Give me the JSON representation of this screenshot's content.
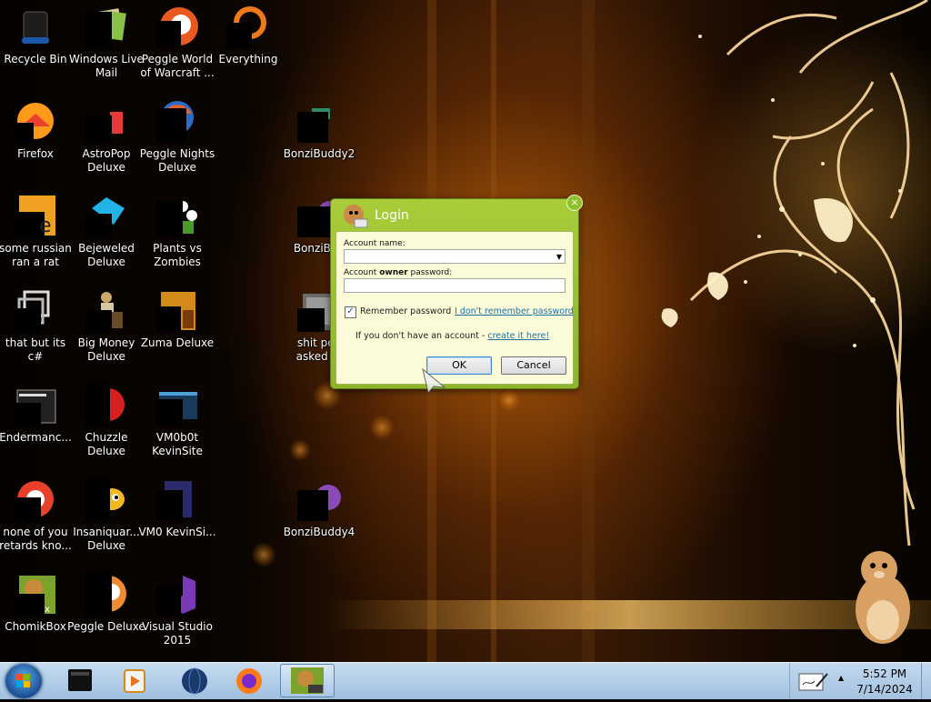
{
  "desktop_icons": [
    {
      "label": "Recycle Bin"
    },
    {
      "label": "Windows Live Mail"
    },
    {
      "label": "Peggle World of Warcraft ..."
    },
    {
      "label": "Everything"
    },
    {
      "label": "Firefox"
    },
    {
      "label": "AstroPop Deluxe"
    },
    {
      "label": "Peggle Nights Deluxe"
    },
    {
      "label": "BonziBuddy2"
    },
    {
      "label": "some russian ran a rat"
    },
    {
      "label": "Bejeweled Deluxe"
    },
    {
      "label": "Plants vs Zombies"
    },
    {
      "label": "BonziBud"
    },
    {
      "label": "that but its c#"
    },
    {
      "label": "Big Money Deluxe"
    },
    {
      "label": "Zuma Deluxe"
    },
    {
      "label": "shit peo asked m"
    },
    {
      "label": "Endermanc..."
    },
    {
      "label": "Chuzzle Deluxe"
    },
    {
      "label": "VM0b0t KevinSite"
    },
    {
      "label": "none of you retards kno..."
    },
    {
      "label": "Insaniquar... Deluxe"
    },
    {
      "label": "VM0 KevinSi..."
    },
    {
      "label": "BonziBuddy4"
    },
    {
      "label": "ChomikBox"
    },
    {
      "label": "Peggle Deluxe"
    },
    {
      "label": "Visual Studio 2015"
    }
  ],
  "dialog": {
    "title": "Login",
    "close_icon": "close-icon",
    "account_name_label": "Account name:",
    "account_name_value": "",
    "password_label_pre": "Account ",
    "password_label_bold": "owner",
    "password_label_post": " password:",
    "password_value": "",
    "remember_label": "Remember password",
    "remember_checked": true,
    "forgot_link": "I don't remember password",
    "no_account_text": "If you don't have an account - ",
    "create_link": "create it here!",
    "ok_label": "OK",
    "cancel_label": "Cancel",
    "accent_color": "#9bc232"
  },
  "taskbar": {
    "buttons": [
      {
        "icon": "start-orb-icon"
      },
      {
        "icon": "recycle-bin-icon"
      },
      {
        "icon": "media-player-icon"
      },
      {
        "icon": "globe-icon"
      },
      {
        "icon": "firefox-icon"
      },
      {
        "icon": "chomikbox-icon",
        "active": true
      }
    ],
    "tray_icon": "handwriting-icon",
    "tray_arrow": "▲",
    "time": "5:52 PM",
    "date": "7/14/2024"
  }
}
